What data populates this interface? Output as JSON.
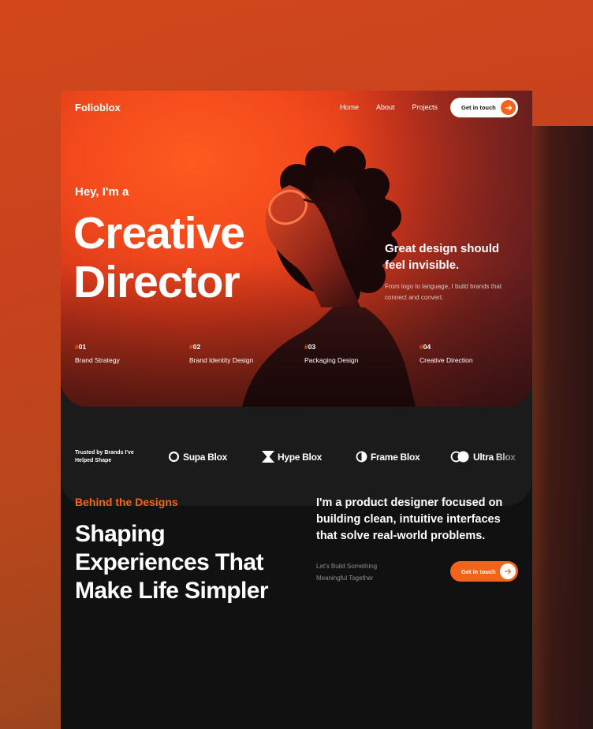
{
  "nav": {
    "logo": "Folioblox",
    "links": [
      "Home",
      "About",
      "Projects"
    ],
    "cta_label": "Get in touch"
  },
  "hero": {
    "greeting": "Hey, I'm a",
    "title_line1": "Creative",
    "title_line2": "Director",
    "tagline": "Great design should feel invisible.",
    "subtext": "From logo to language, I build brands that connect and convert.",
    "services": [
      {
        "hash": "#",
        "num": "01",
        "label": "Brand Strategy"
      },
      {
        "hash": "#",
        "num": "02",
        "label": "Brand Identity Design"
      },
      {
        "hash": "#",
        "num": "03",
        "label": "Packaging Design"
      },
      {
        "hash": "#",
        "num": "04",
        "label": "Creative Direction"
      }
    ]
  },
  "brands": {
    "heading": "Trusted by Brands I've Helped Shape",
    "items": [
      {
        "name": "Supa Blox",
        "icon": "ring-icon"
      },
      {
        "name": "Hype Blox",
        "icon": "hourglass-icon"
      },
      {
        "name": "Frame Blox",
        "icon": "half-circle-icon"
      },
      {
        "name": "Ultra Blox",
        "icon": "double-circle-icon"
      }
    ]
  },
  "about": {
    "eyebrow": "Behind the Designs",
    "title": "Shaping Experiences That Make Life Simpler",
    "statement": "I'm a product designer focused on building clean, intuitive interfaces that solve real-world problems.",
    "small_line1": "Let's Build Something",
    "small_line2": "Meaningful Together",
    "cta_label": "Get in touch"
  },
  "colors": {
    "accent": "#f26419",
    "dark": "#111111",
    "band": "#1b1b1b"
  }
}
